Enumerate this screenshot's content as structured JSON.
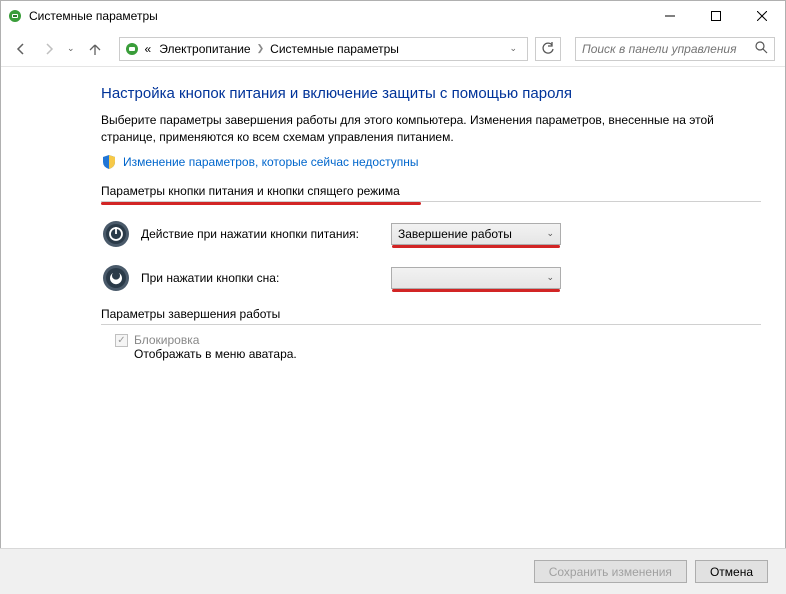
{
  "window": {
    "title": "Системные параметры"
  },
  "breadcrumb": {
    "prefix": "«",
    "seg1": "Электропитание",
    "seg2": "Системные параметры"
  },
  "search": {
    "placeholder": "Поиск в панели управления"
  },
  "main": {
    "heading": "Настройка кнопок питания и включение защиты с помощью пароля",
    "description": "Выберите параметры завершения работы для этого компьютера. Изменения параметров, внесенные на этой странице, применяются ко всем схемам управления питанием.",
    "change_link": "Изменение параметров, которые сейчас недоступны"
  },
  "section1": {
    "header": "Параметры кнопки питания и кнопки спящего режима",
    "power_btn_label": "Действие при нажатии кнопки питания:",
    "power_btn_value": "Завершение работы",
    "sleep_btn_label": "При нажатии кнопки сна:",
    "sleep_btn_value": ""
  },
  "section2": {
    "header": "Параметры завершения работы",
    "lock_title": "Блокировка",
    "lock_desc": "Отображать в меню аватара."
  },
  "footer": {
    "save": "Сохранить изменения",
    "cancel": "Отмена"
  }
}
